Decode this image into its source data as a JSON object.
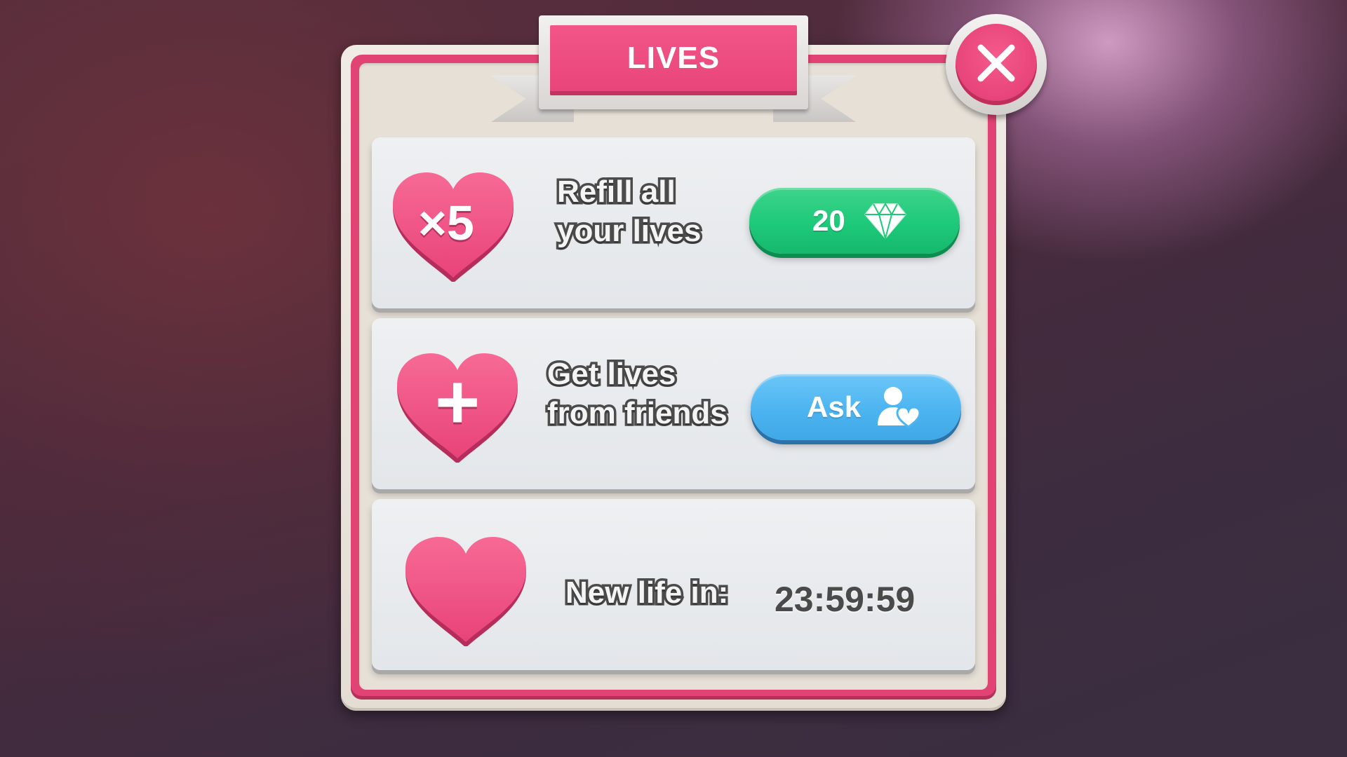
{
  "dialog": {
    "title": "LIVES"
  },
  "close_button": {
    "icon": "close-icon"
  },
  "rows": [
    {
      "icon": "heart-icon",
      "heart_label": "×5",
      "text_line1": "Refill all",
      "text_line2": "your lives",
      "button_label": "20",
      "button_icon": "diamond-icon",
      "button_color": "#1ec97a"
    },
    {
      "icon": "heart-icon",
      "heart_label": "+",
      "text_line1": "Get lives",
      "text_line2": "from friends",
      "button_label": "Ask",
      "button_icon": "friend-heart-icon",
      "button_color": "#4cb4f0"
    },
    {
      "icon": "heart-icon",
      "text_line1": "New life in:",
      "timer": "23:59:59"
    }
  ],
  "colors": {
    "accent_pink": "#e8457a",
    "panel": "#e6e0d7",
    "card": "#e9ecef"
  }
}
